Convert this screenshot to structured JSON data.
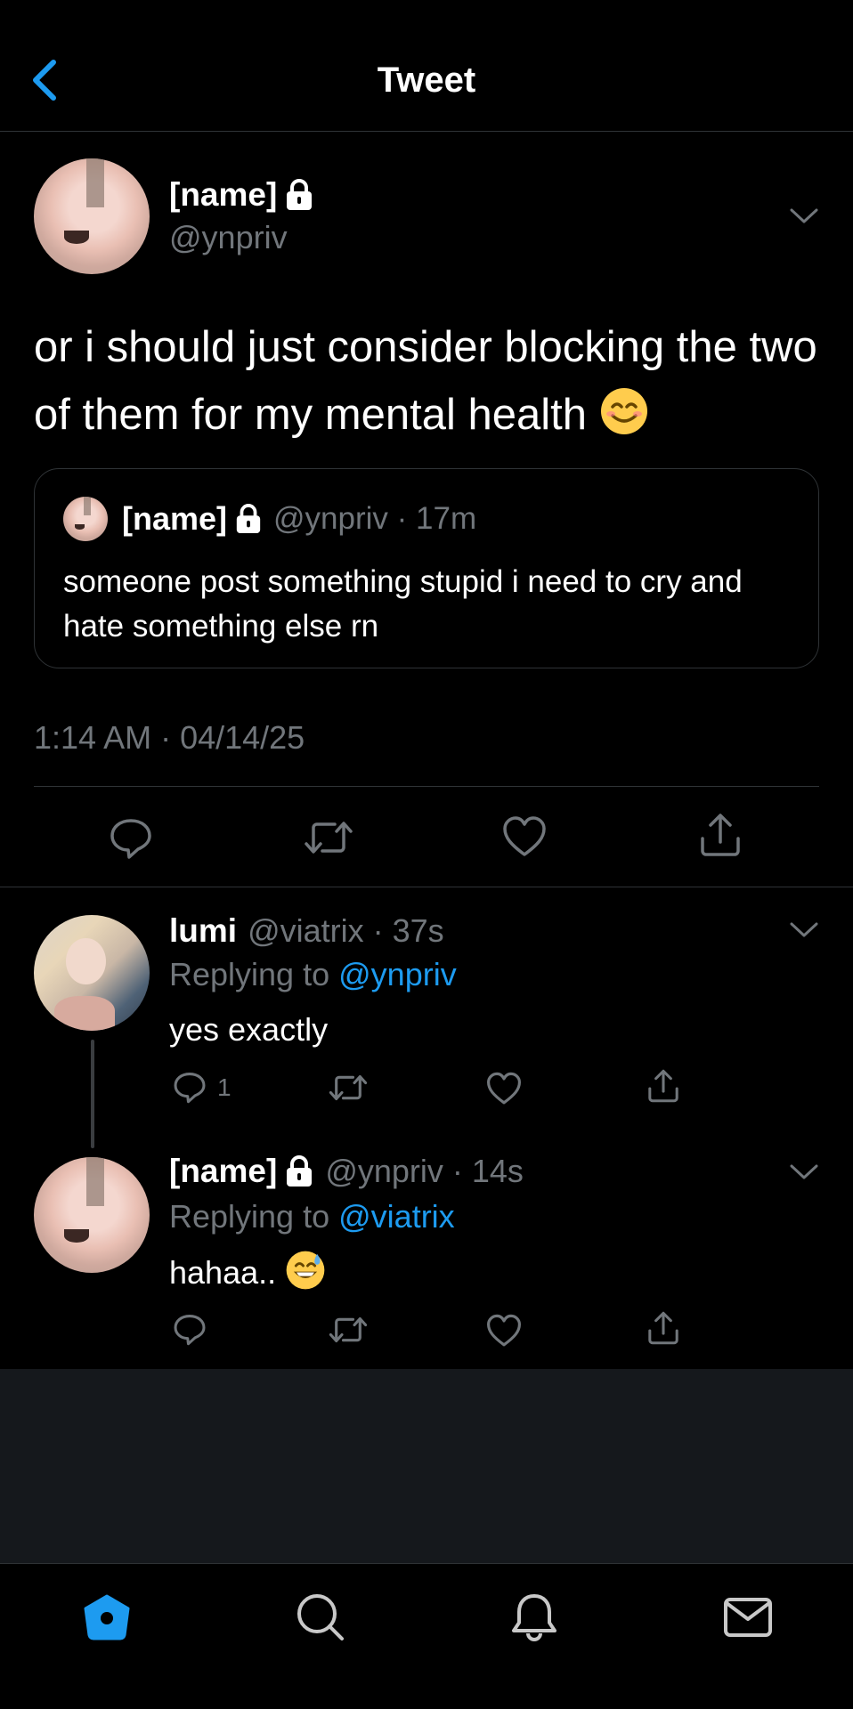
{
  "header": {
    "title": "Tweet",
    "back_icon": "chevron-left-icon",
    "accent_color": "#1d9bf0"
  },
  "main_tweet": {
    "display_name": "[name]",
    "handle": "@ynpriv",
    "text": "or i should just consider blocking the two of them for my mental health",
    "emoji": "smiling-face-icon",
    "quoted": {
      "display_name": "[name]",
      "handle": "@ynpriv · 17m",
      "text": "someone post something stupid i need to cry and hate something else rn"
    },
    "timestamp": "1:14 AM · 04/14/25"
  },
  "replies": [
    {
      "display_name": "lumi",
      "handle": "@viatrix · 37s",
      "replying_prefix": "Replying to",
      "replying_to": "@ynpriv",
      "text": "yes exactly",
      "reply_count": "1"
    },
    {
      "display_name": "[name]",
      "handle": "@ynpriv · 14s",
      "replying_prefix": "Replying to",
      "replying_to": "@viatrix",
      "text": "hahaa..",
      "emoji": "grinning-sweat-face-icon"
    }
  ],
  "tabbar": {
    "items": [
      "home-icon",
      "search-icon",
      "notifications-icon",
      "messages-icon"
    ],
    "active": "home-icon"
  }
}
